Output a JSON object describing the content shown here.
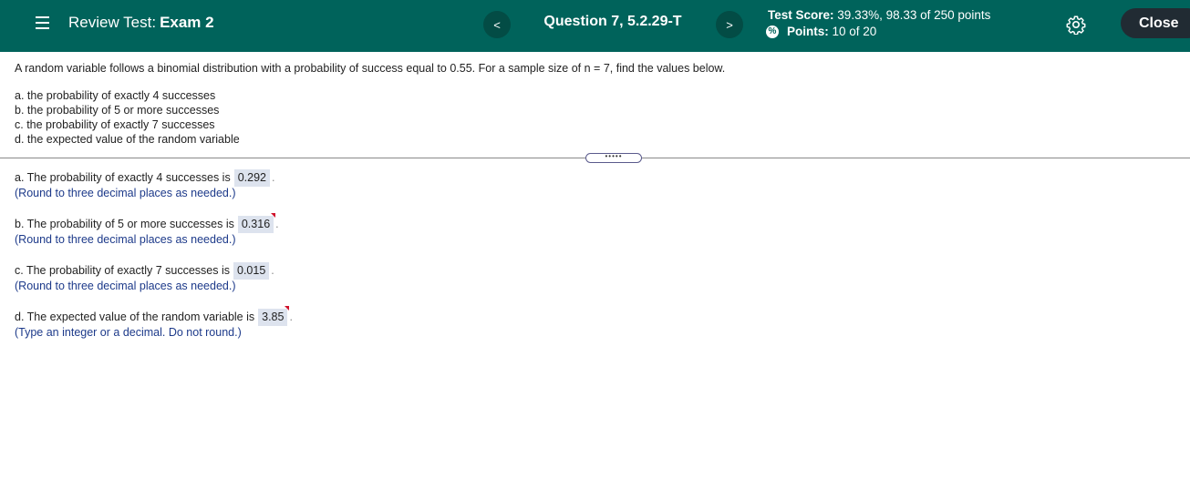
{
  "header": {
    "title_prefix": "Review Test:",
    "title_exam": "Exam 2",
    "prev_label": "<",
    "next_label": ">",
    "question_label": "Question 7, 5.2.29-T",
    "score_label": "Test Score:",
    "score_value": "39.33%, 98.33 of 250 points",
    "points_label": "Points:",
    "points_value": "10 of 20",
    "close_label": "Close",
    "colors": {
      "bar": "#00635b",
      "close_button": "#212b33"
    }
  },
  "problem": {
    "intro": "A random variable follows a binomial distribution with a probability of success equal to 0.55. For a sample size of n = 7, find the values below.",
    "parts": [
      "a. the probability of exactly 4 successes",
      "b. the probability of 5 or more successes",
      "c. the probability of exactly 7 successes",
      "d. the expected value of the random variable"
    ]
  },
  "divider_label": "•••••",
  "answers": [
    {
      "text": "a. The probability of exactly 4 successes is",
      "value": "0.292",
      "hint": "(Round to three decimal places as needed.)"
    },
    {
      "text": "b. The probability of 5 or more successes is",
      "value": "0.316",
      "hint": "(Round to three decimal places as needed.)"
    },
    {
      "text": "c. The probability of exactly 7 successes is",
      "value": "0.015",
      "hint": "(Round to three decimal places as needed.)"
    },
    {
      "text": "d. The expected value of the random variable is",
      "value": "3.85",
      "hint": "(Type an integer or a decimal. Do not round.)"
    }
  ]
}
